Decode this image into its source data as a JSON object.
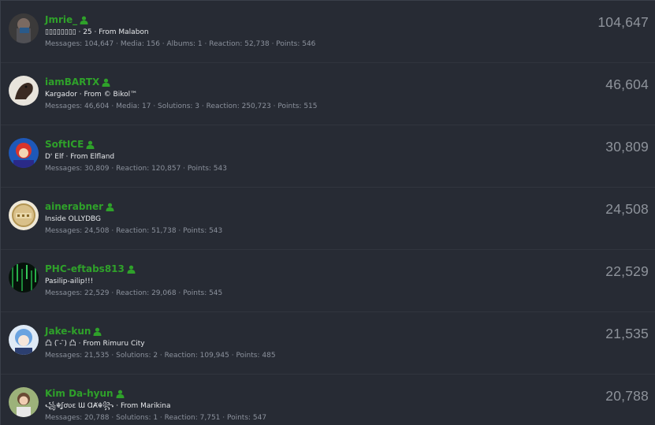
{
  "members": [
    {
      "username": "Jmrie_",
      "blurb": "▯▯▯▯▯▯▯▯ · 25 · From Malabon",
      "stats": "Messages: 104,647 · Media: 156 · Albums: 1 · Reaction: 52,738 · Points: 546",
      "total": "104,647",
      "avatar": "avatar-dark-portrait"
    },
    {
      "username": "iamBARTX",
      "blurb": "Kargador · From © Bikol™",
      "stats": "Messages: 46,604 · Media: 17 · Solutions: 3 · Reaction: 250,723 · Points: 515",
      "total": "46,604",
      "avatar": "avatar-horse"
    },
    {
      "username": "SoftICE",
      "blurb": "D' Elf · From Elfland",
      "stats": "Messages: 30,809 · Reaction: 120,857 · Points: 543",
      "total": "30,809",
      "avatar": "avatar-cartoon"
    },
    {
      "username": "ainerabner",
      "blurb": "Inside OLLYDBG",
      "stats": "Messages: 24,508 · Reaction: 51,738 · Points: 543",
      "total": "24,508",
      "avatar": "avatar-vip-badge"
    },
    {
      "username": "PHC-eftabs813",
      "blurb": "Pasilip-ailip!!!",
      "stats": "Messages: 22,529 · Reaction: 29,068 · Points: 545",
      "total": "22,529",
      "avatar": "avatar-matrix"
    },
    {
      "username": "Jake-kun",
      "blurb": "凸 ( ̄- ̄) 凸 · From Rimuru City",
      "stats": "Messages: 21,535 · Solutions: 2 · Reaction: 109,945 · Points: 485",
      "total": "21,535",
      "avatar": "avatar-anime-blue"
    },
    {
      "username": "Kim Da-hyun",
      "blurb": "꧁☬ʆơʋɛ Ɯ ⱭȺ☬꧂ · From Marikina",
      "stats": "Messages: 20,788 · Solutions: 1 · Reaction: 7,751 · Points: 547",
      "total": "20,788",
      "avatar": "avatar-outdoor"
    }
  ],
  "colors": {
    "background": "#272b34",
    "username": "#2fa12a",
    "total": "#8e939b",
    "stats": "#8b919c"
  },
  "icons": {
    "user_badge": "user-icon"
  }
}
